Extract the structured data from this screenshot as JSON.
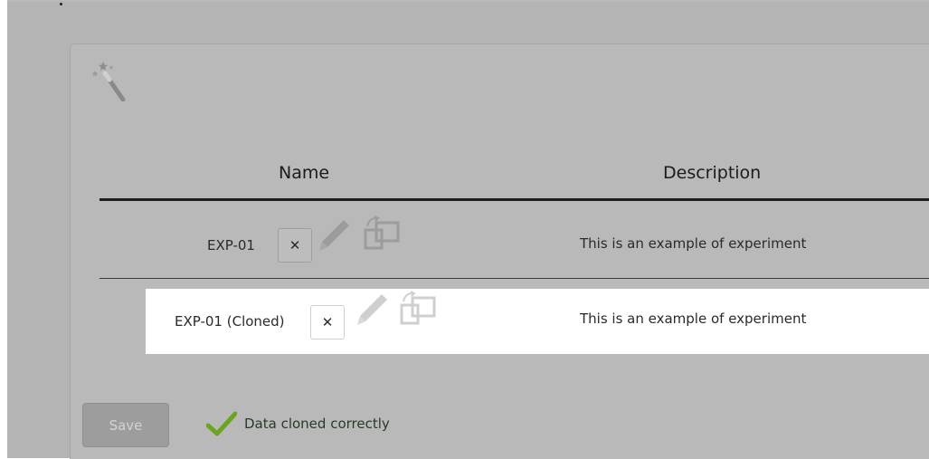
{
  "table": {
    "headers": {
      "name": "Name",
      "description": "Description"
    },
    "rows": [
      {
        "name": "EXP-01",
        "description": "This is an example of experiment",
        "remove_label": "✕"
      },
      {
        "name": "EXP-01 (Cloned)",
        "description": "This is an example of experiment",
        "remove_label": "✕"
      }
    ]
  },
  "footer": {
    "save_label": "Save",
    "status_text": "Data cloned correctly"
  },
  "icons": {
    "wizard": "magic-wand-icon",
    "edit": "pencil-icon",
    "clone": "clone-icon",
    "status": "checkmark-icon"
  },
  "colors": {
    "success": "#6aa51e",
    "overlay": "#b4b4b4",
    "highlight_row": "#ffffff"
  }
}
